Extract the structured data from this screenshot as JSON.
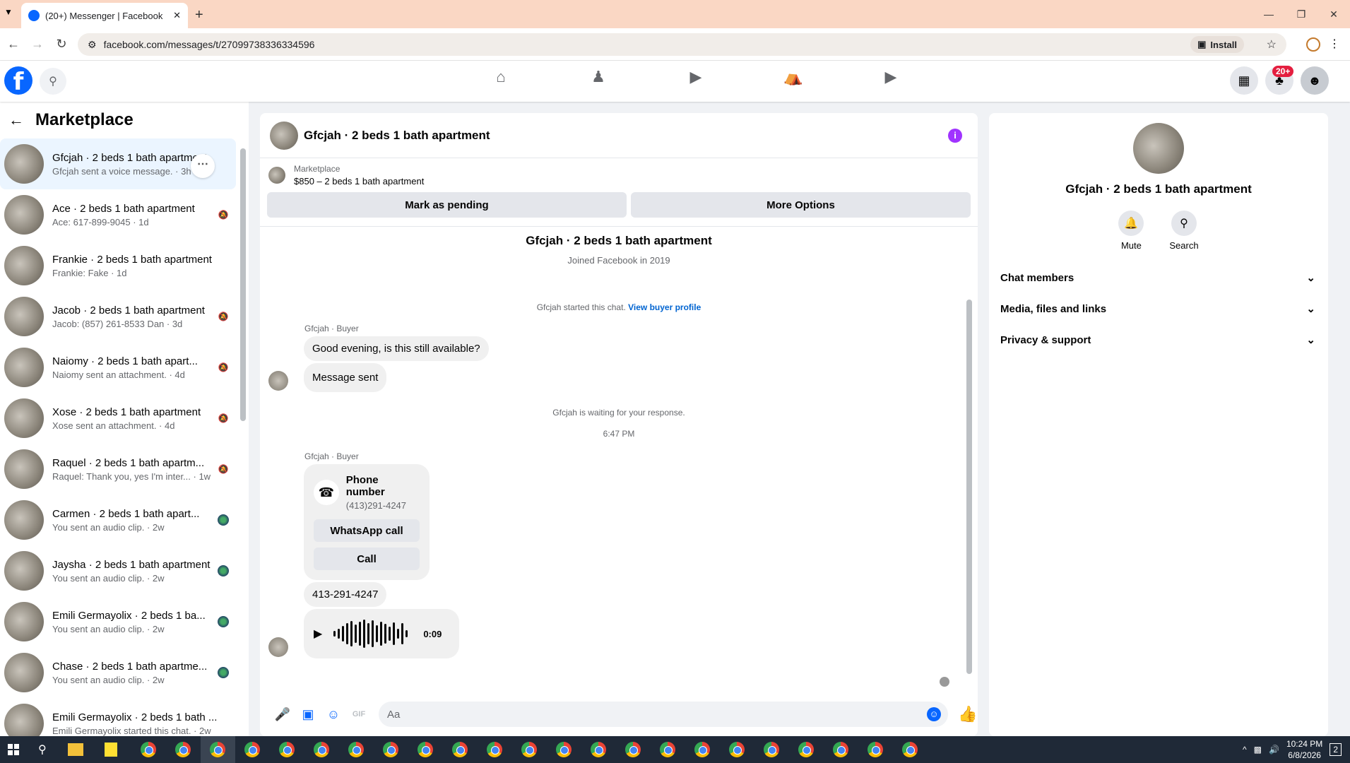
{
  "browser": {
    "tab_title": "(20+) Messenger | Facebook",
    "url": "facebook.com/messages/t/27099738336334596",
    "install_label": "Install"
  },
  "header": {
    "notification_badge": "20+"
  },
  "sidebar": {
    "title": "Marketplace",
    "conversations": [
      {
        "name": "Gfcjah · 2 beds 1 bath apartment",
        "sub": "Gfcjah sent a voice message. · 3h",
        "active": true
      },
      {
        "name": "Ace · 2 beds 1 bath apartment",
        "sub": "Ace: 617-899-9045 · 1d"
      },
      {
        "name": "Frankie · 2 beds 1 bath apartment",
        "sub": "Frankie: Fake · 1d"
      },
      {
        "name": "Jacob · 2 beds 1 bath apartment",
        "sub": "Jacob: (857) 261-8533 Dan · 3d"
      },
      {
        "name": "Naiomy · 2 beds 1 bath apart...",
        "sub": "Naiomy sent an attachment. · 4d"
      },
      {
        "name": "Xose · 2 beds 1 bath apartment",
        "sub": "Xose sent an attachment. · 4d"
      },
      {
        "name": "Raquel · 2 beds 1 bath apartm...",
        "sub": "Raquel: Thank you, yes I'm inter... · 1w"
      },
      {
        "name": "Carmen · 2 beds 1 bath apart...",
        "sub": "You sent an audio clip. · 2w"
      },
      {
        "name": "Jaysha · 2 beds 1 bath apartment",
        "sub": "You sent an audio clip. · 2w"
      },
      {
        "name": "Emili Germayolix · 2 beds 1 ba...",
        "sub": "You sent an audio clip. · 2w"
      },
      {
        "name": "Chase · 2 beds 1 bath apartme...",
        "sub": "You sent an audio clip. · 2w"
      },
      {
        "name": "Emili Germayolix · 2 beds 1 bath ...",
        "sub": "Emili Germayolix started this chat. · 2w"
      }
    ]
  },
  "chat": {
    "title": "Gfcjah · 2 beds 1 bath apartment",
    "marketplace_label": "Marketplace",
    "listing": "$850 – 2 beds 1 bath apartment",
    "mark_pending": "Mark as pending",
    "more_options": "More Options",
    "intro_title": "Gfcjah · 2 beds 1 bath apartment",
    "joined": "Joined Facebook in 2019",
    "started": "Gfcjah started this chat.",
    "view_profile": "View buyer profile",
    "sender_label": "Gfcjah · Buyer",
    "msg1": "Good evening, is this still available?",
    "msg2": "Message sent",
    "waiting": "Gfcjah is waiting for your response.",
    "time": "6:47 PM",
    "phone_title": "Phone number",
    "phone_number": "(413)291-4247",
    "whatsapp": "WhatsApp call",
    "call": "Call",
    "msg3": "413-291-4247",
    "audio_duration": "0:09",
    "composer_placeholder": "Aa"
  },
  "details": {
    "name": "Gfcjah · 2 beds 1 bath apartment",
    "mute": "Mute",
    "search": "Search",
    "sections": [
      "Chat members",
      "Media, files and links",
      "Privacy & support"
    ]
  },
  "taskbar": {
    "time": "10:24 PM",
    "date": "6/8/2026",
    "notif": "2"
  }
}
